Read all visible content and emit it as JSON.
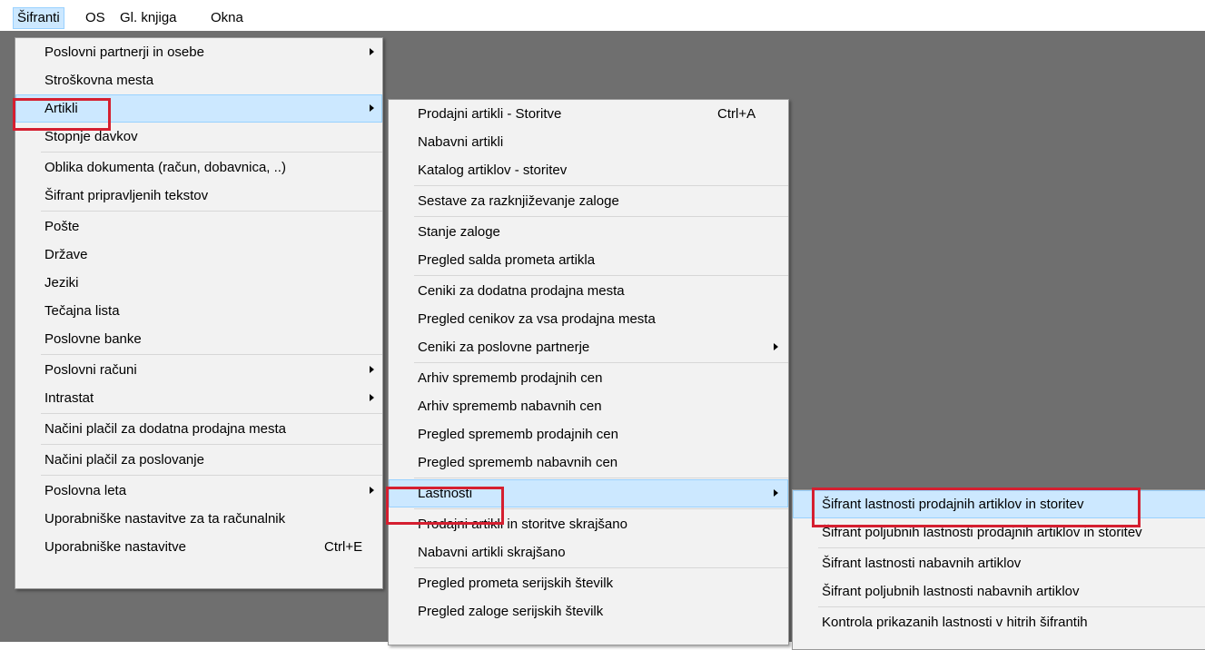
{
  "menubar": {
    "items": [
      {
        "label": "Šifranti",
        "active": true
      },
      {
        "label": "OS"
      },
      {
        "label": "Gl. knjiga"
      },
      {
        "label": "Okna"
      }
    ]
  },
  "menu1": {
    "items": [
      {
        "label": "Poslovni partnerji in osebe",
        "submenu": true
      },
      {
        "label": "Stroškovna mesta"
      },
      {
        "label": "Artikli",
        "submenu": true,
        "highlighted": true
      },
      {
        "label": "Stopnje davkov"
      },
      {
        "label": "Oblika dokumenta (račun, dobavnica, ..)"
      },
      {
        "label": "Šifrant pripravljenih tekstov"
      },
      {
        "label": "Pošte"
      },
      {
        "label": "Države"
      },
      {
        "label": "Jeziki"
      },
      {
        "label": "Tečajna lista"
      },
      {
        "label": "Poslovne banke"
      },
      {
        "label": "Poslovni računi",
        "submenu": true
      },
      {
        "label": "Intrastat",
        "submenu": true
      },
      {
        "label": "Načini plačil za dodatna prodajna mesta"
      },
      {
        "label": "Načini plačil za poslovanje"
      },
      {
        "label": "Poslovna leta",
        "submenu": true
      },
      {
        "label": "Uporabniške nastavitve za ta računalnik"
      },
      {
        "label": "Uporabniške nastavitve",
        "shortcut": "Ctrl+E"
      }
    ]
  },
  "menu2": {
    "items": [
      {
        "label": "Prodajni artikli - Storitve",
        "shortcut": "Ctrl+A"
      },
      {
        "label": "Nabavni artikli"
      },
      {
        "label": "Katalog artiklov - storitev"
      },
      {
        "label": "Sestave za razknjiževanje zaloge"
      },
      {
        "label": "Stanje zaloge"
      },
      {
        "label": "Pregled salda prometa artikla"
      },
      {
        "label": "Ceniki za dodatna prodajna mesta"
      },
      {
        "label": "Pregled cenikov za vsa prodajna mesta"
      },
      {
        "label": "Ceniki za poslovne partnerje",
        "submenu": true
      },
      {
        "label": "Arhiv sprememb prodajnih cen"
      },
      {
        "label": "Arhiv sprememb nabavnih cen"
      },
      {
        "label": "Pregled sprememb prodajnih cen"
      },
      {
        "label": "Pregled sprememb nabavnih cen"
      },
      {
        "label": "Lastnosti",
        "submenu": true,
        "highlighted": true
      },
      {
        "label": "Prodajni artikli in storitve skrajšano"
      },
      {
        "label": "Nabavni artikli skrajšano"
      },
      {
        "label": "Pregled prometa serijskih številk"
      },
      {
        "label": "Pregled zaloge serijskih številk"
      }
    ]
  },
  "menu3": {
    "items": [
      {
        "label": "Šifrant lastnosti prodajnih artiklov in storitev",
        "highlighted": true
      },
      {
        "label": "Šifrant poljubnih lastnosti prodajnih artiklov in storitev"
      },
      {
        "label": "Šifrant lastnosti nabavnih artiklov"
      },
      {
        "label": "Šifrant poljubnih lastnosti nabavnih artiklov"
      },
      {
        "label": "Kontrola prikazanih lastnosti v hitrih šifrantih"
      }
    ]
  },
  "colors": {
    "desktop": "#6f6f6f",
    "menu_bg": "#f2f2f2",
    "highlight": "#cce8ff",
    "highlight_border": "#99d1ff",
    "annotation_red": "#d51f30"
  }
}
